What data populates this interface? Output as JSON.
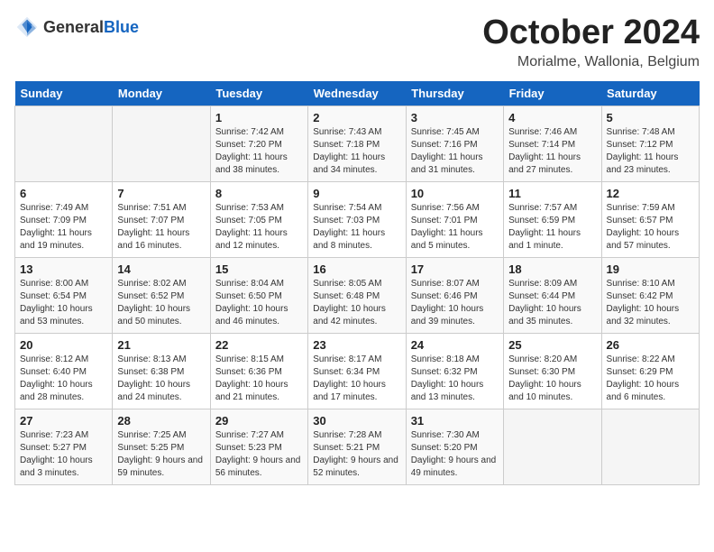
{
  "header": {
    "logo_general": "General",
    "logo_blue": "Blue",
    "month": "October 2024",
    "location": "Morialme, Wallonia, Belgium"
  },
  "days_of_week": [
    "Sunday",
    "Monday",
    "Tuesday",
    "Wednesday",
    "Thursday",
    "Friday",
    "Saturday"
  ],
  "weeks": [
    [
      {
        "day": "",
        "sunrise": "",
        "sunset": "",
        "daylight": ""
      },
      {
        "day": "",
        "sunrise": "",
        "sunset": "",
        "daylight": ""
      },
      {
        "day": "1",
        "sunrise": "Sunrise: 7:42 AM",
        "sunset": "Sunset: 7:20 PM",
        "daylight": "Daylight: 11 hours and 38 minutes."
      },
      {
        "day": "2",
        "sunrise": "Sunrise: 7:43 AM",
        "sunset": "Sunset: 7:18 PM",
        "daylight": "Daylight: 11 hours and 34 minutes."
      },
      {
        "day": "3",
        "sunrise": "Sunrise: 7:45 AM",
        "sunset": "Sunset: 7:16 PM",
        "daylight": "Daylight: 11 hours and 31 minutes."
      },
      {
        "day": "4",
        "sunrise": "Sunrise: 7:46 AM",
        "sunset": "Sunset: 7:14 PM",
        "daylight": "Daylight: 11 hours and 27 minutes."
      },
      {
        "day": "5",
        "sunrise": "Sunrise: 7:48 AM",
        "sunset": "Sunset: 7:12 PM",
        "daylight": "Daylight: 11 hours and 23 minutes."
      }
    ],
    [
      {
        "day": "6",
        "sunrise": "Sunrise: 7:49 AM",
        "sunset": "Sunset: 7:09 PM",
        "daylight": "Daylight: 11 hours and 19 minutes."
      },
      {
        "day": "7",
        "sunrise": "Sunrise: 7:51 AM",
        "sunset": "Sunset: 7:07 PM",
        "daylight": "Daylight: 11 hours and 16 minutes."
      },
      {
        "day": "8",
        "sunrise": "Sunrise: 7:53 AM",
        "sunset": "Sunset: 7:05 PM",
        "daylight": "Daylight: 11 hours and 12 minutes."
      },
      {
        "day": "9",
        "sunrise": "Sunrise: 7:54 AM",
        "sunset": "Sunset: 7:03 PM",
        "daylight": "Daylight: 11 hours and 8 minutes."
      },
      {
        "day": "10",
        "sunrise": "Sunrise: 7:56 AM",
        "sunset": "Sunset: 7:01 PM",
        "daylight": "Daylight: 11 hours and 5 minutes."
      },
      {
        "day": "11",
        "sunrise": "Sunrise: 7:57 AM",
        "sunset": "Sunset: 6:59 PM",
        "daylight": "Daylight: 11 hours and 1 minute."
      },
      {
        "day": "12",
        "sunrise": "Sunrise: 7:59 AM",
        "sunset": "Sunset: 6:57 PM",
        "daylight": "Daylight: 10 hours and 57 minutes."
      }
    ],
    [
      {
        "day": "13",
        "sunrise": "Sunrise: 8:00 AM",
        "sunset": "Sunset: 6:54 PM",
        "daylight": "Daylight: 10 hours and 53 minutes."
      },
      {
        "day": "14",
        "sunrise": "Sunrise: 8:02 AM",
        "sunset": "Sunset: 6:52 PM",
        "daylight": "Daylight: 10 hours and 50 minutes."
      },
      {
        "day": "15",
        "sunrise": "Sunrise: 8:04 AM",
        "sunset": "Sunset: 6:50 PM",
        "daylight": "Daylight: 10 hours and 46 minutes."
      },
      {
        "day": "16",
        "sunrise": "Sunrise: 8:05 AM",
        "sunset": "Sunset: 6:48 PM",
        "daylight": "Daylight: 10 hours and 42 minutes."
      },
      {
        "day": "17",
        "sunrise": "Sunrise: 8:07 AM",
        "sunset": "Sunset: 6:46 PM",
        "daylight": "Daylight: 10 hours and 39 minutes."
      },
      {
        "day": "18",
        "sunrise": "Sunrise: 8:09 AM",
        "sunset": "Sunset: 6:44 PM",
        "daylight": "Daylight: 10 hours and 35 minutes."
      },
      {
        "day": "19",
        "sunrise": "Sunrise: 8:10 AM",
        "sunset": "Sunset: 6:42 PM",
        "daylight": "Daylight: 10 hours and 32 minutes."
      }
    ],
    [
      {
        "day": "20",
        "sunrise": "Sunrise: 8:12 AM",
        "sunset": "Sunset: 6:40 PM",
        "daylight": "Daylight: 10 hours and 28 minutes."
      },
      {
        "day": "21",
        "sunrise": "Sunrise: 8:13 AM",
        "sunset": "Sunset: 6:38 PM",
        "daylight": "Daylight: 10 hours and 24 minutes."
      },
      {
        "day": "22",
        "sunrise": "Sunrise: 8:15 AM",
        "sunset": "Sunset: 6:36 PM",
        "daylight": "Daylight: 10 hours and 21 minutes."
      },
      {
        "day": "23",
        "sunrise": "Sunrise: 8:17 AM",
        "sunset": "Sunset: 6:34 PM",
        "daylight": "Daylight: 10 hours and 17 minutes."
      },
      {
        "day": "24",
        "sunrise": "Sunrise: 8:18 AM",
        "sunset": "Sunset: 6:32 PM",
        "daylight": "Daylight: 10 hours and 13 minutes."
      },
      {
        "day": "25",
        "sunrise": "Sunrise: 8:20 AM",
        "sunset": "Sunset: 6:30 PM",
        "daylight": "Daylight: 10 hours and 10 minutes."
      },
      {
        "day": "26",
        "sunrise": "Sunrise: 8:22 AM",
        "sunset": "Sunset: 6:29 PM",
        "daylight": "Daylight: 10 hours and 6 minutes."
      }
    ],
    [
      {
        "day": "27",
        "sunrise": "Sunrise: 7:23 AM",
        "sunset": "Sunset: 5:27 PM",
        "daylight": "Daylight: 10 hours and 3 minutes."
      },
      {
        "day": "28",
        "sunrise": "Sunrise: 7:25 AM",
        "sunset": "Sunset: 5:25 PM",
        "daylight": "Daylight: 9 hours and 59 minutes."
      },
      {
        "day": "29",
        "sunrise": "Sunrise: 7:27 AM",
        "sunset": "Sunset: 5:23 PM",
        "daylight": "Daylight: 9 hours and 56 minutes."
      },
      {
        "day": "30",
        "sunrise": "Sunrise: 7:28 AM",
        "sunset": "Sunset: 5:21 PM",
        "daylight": "Daylight: 9 hours and 52 minutes."
      },
      {
        "day": "31",
        "sunrise": "Sunrise: 7:30 AM",
        "sunset": "Sunset: 5:20 PM",
        "daylight": "Daylight: 9 hours and 49 minutes."
      },
      {
        "day": "",
        "sunrise": "",
        "sunset": "",
        "daylight": ""
      },
      {
        "day": "",
        "sunrise": "",
        "sunset": "",
        "daylight": ""
      }
    ]
  ]
}
